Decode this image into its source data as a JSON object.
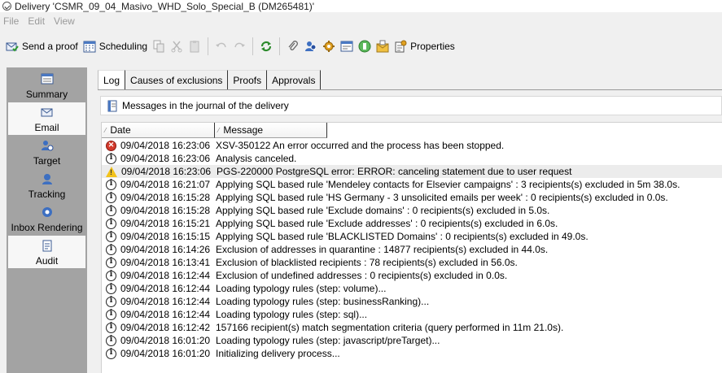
{
  "window": {
    "title": "Delivery 'CSMR_09_04_Masivo_WHD_Solo_Special_B (DM265481)'"
  },
  "menu": {
    "file": "File",
    "edit": "Edit",
    "view": "View"
  },
  "toolbar": {
    "send_proof": "Send a proof",
    "scheduling": "Scheduling",
    "properties": "Properties"
  },
  "nav": {
    "summary": "Summary",
    "email": "Email",
    "target": "Target",
    "tracking": "Tracking",
    "inbox_rendering": "Inbox Rendering",
    "audit": "Audit"
  },
  "tabs": {
    "log": "Log",
    "causes": "Causes of exclusions",
    "proofs": "Proofs",
    "approvals": "Approvals"
  },
  "section": {
    "title": "Messages in the journal of the delivery"
  },
  "grid": {
    "col_date": "Date",
    "col_message": "Message",
    "rows": [
      {
        "type": "error",
        "date": "09/04/2018 16:23:06",
        "message": "XSV-350122 An error occurred and the process has been stopped."
      },
      {
        "type": "info",
        "date": "09/04/2018 16:23:06",
        "message": "Analysis canceled."
      },
      {
        "type": "warning",
        "date": "09/04/2018 16:23:06",
        "message": "PGS-220000 PostgreSQL error: ERROR:  canceling statement due to user request"
      },
      {
        "type": "info",
        "date": "09/04/2018 16:21:07",
        "message": "Applying SQL based rule 'Mendeley contacts for Elsevier campaigns' : 3 recipients(s) excluded in 5m  38.0s."
      },
      {
        "type": "info",
        "date": "09/04/2018 16:15:28",
        "message": "Applying SQL based rule 'HS Germany - 3 unsolicited emails per week' : 0 recipients(s) excluded in 0.0s."
      },
      {
        "type": "info",
        "date": "09/04/2018 16:15:28",
        "message": "Applying SQL based rule 'Exclude domains' : 0 recipients(s) excluded in 5.0s."
      },
      {
        "type": "info",
        "date": "09/04/2018 16:15:21",
        "message": "Applying SQL based rule 'Exclude addresses' : 0 recipients(s) excluded in 6.0s."
      },
      {
        "type": "info",
        "date": "09/04/2018 16:15:15",
        "message": "Applying SQL based rule 'BLACKLISTED Domains' : 0 recipients(s) excluded in 49.0s."
      },
      {
        "type": "info",
        "date": "09/04/2018 16:14:26",
        "message": "Exclusion of addresses in quarantine : 14877 recipients(s) excluded in 44.0s."
      },
      {
        "type": "info",
        "date": "09/04/2018 16:13:41",
        "message": "Exclusion of blacklisted recipients : 78 recipients(s) excluded in 56.0s."
      },
      {
        "type": "info",
        "date": "09/04/2018 16:12:44",
        "message": "Exclusion of undefined addresses : 0 recipients(s) excluded in 0.0s."
      },
      {
        "type": "info",
        "date": "09/04/2018 16:12:44",
        "message": "Loading typology rules (step: volume)..."
      },
      {
        "type": "info",
        "date": "09/04/2018 16:12:44",
        "message": "Loading typology rules (step: businessRanking)..."
      },
      {
        "type": "info",
        "date": "09/04/2018 16:12:44",
        "message": "Loading typology rules (step: sql)..."
      },
      {
        "type": "info",
        "date": "09/04/2018 16:12:42",
        "message": "157166 recipient(s) match segmentation criteria (query performed in 11m  21.0s)."
      },
      {
        "type": "info",
        "date": "09/04/2018 16:01:20",
        "message": "Loading typology rules (step: javascript/preTarget)..."
      },
      {
        "type": "info",
        "date": "09/04/2018 16:01:20",
        "message": "Initializing delivery process..."
      }
    ]
  },
  "colors": {
    "nav_background": "#a3a3a3",
    "nav_selected": "#f7f7f7",
    "error_red": "#d33a2c",
    "warning_yellow": "#f2c21b",
    "selected_row": "#ececec"
  }
}
